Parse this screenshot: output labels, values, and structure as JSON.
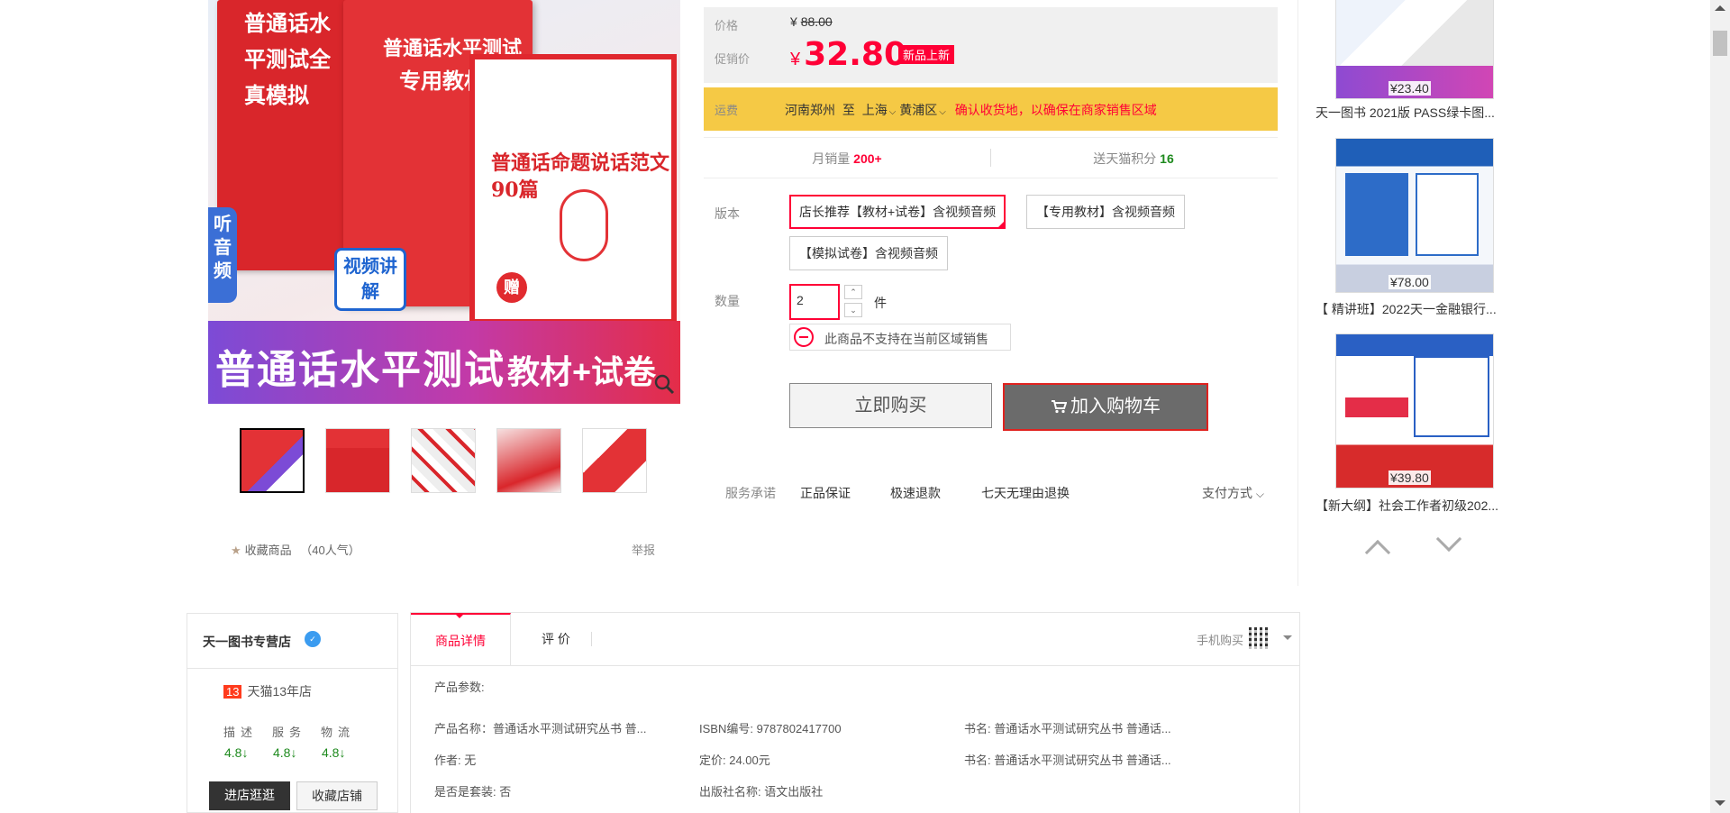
{
  "gallery": {
    "main_image": {
      "book_left_title": "普通话水平测试全真模拟",
      "book_center_title": "普通话水平测试",
      "book_center_subtitle": "专用教材",
      "book_right_title": "普通话命题说话范文90篇",
      "banner_text": "普通话水平测试",
      "banner_right": "教材+试卷",
      "listen_label": "听音频",
      "video_label": "视频讲解",
      "gift_label": "赠"
    },
    "thumbnails": [
      "main",
      "thumb-2",
      "thumb-3",
      "thumb-4",
      "thumb-5"
    ],
    "selected_thumbnail": 0,
    "favorite_label": "收藏商品",
    "favorite_count": "（40人气）",
    "report_label": "举报"
  },
  "price": {
    "list_label": "价格",
    "currency": "¥",
    "list_price": "88.00",
    "promo_label": "促销价",
    "promo_price": "32.80",
    "new_badge": "新品上新"
  },
  "shipping": {
    "label": "运费",
    "from": "河南郑州",
    "to_word": "至",
    "city": "上海",
    "district": "黄浦区",
    "warning": "确认收货地，以确保在商家销售区域"
  },
  "stats": {
    "monthly_sales_label": "月销量",
    "monthly_sales": "200+",
    "points_label": "送天猫积分",
    "points": "16"
  },
  "options": {
    "version_label": "版本",
    "versions": [
      "店长推荐【教材+试卷】含视频音频",
      "【专用教材】含视频音频",
      "【模拟试卷】含视频音频"
    ],
    "selected_version": 0,
    "quantity_label": "数量",
    "quantity": "2",
    "unit": "件",
    "region_notice": "此商品不支持在当前区域销售"
  },
  "actions": {
    "buy_now": "立即购买",
    "add_to_cart": "加入购物车"
  },
  "service": {
    "label": "服务承诺",
    "items": [
      "正品保证",
      "极速退款",
      "七天无理由退换"
    ],
    "payment": "支付方式"
  },
  "recommendations": [
    {
      "price": "¥23.40",
      "title": "天一图书 2021版 PASS绿卡图..."
    },
    {
      "price": "¥78.00",
      "title": "【 精讲班】2022天一金融银行..."
    },
    {
      "price": "¥39.80",
      "title": "【新大纲】社会工作者初级202..."
    }
  ],
  "shop": {
    "name": "天一图书专营店",
    "years_num": "13",
    "years_label": "天猫13年店",
    "score_labels": [
      "描述",
      "服务",
      "物流"
    ],
    "scores": [
      "4.8↓",
      "4.8↓",
      "4.8↓"
    ],
    "enter_button": "进店逛逛",
    "favorite_button": "收藏店铺"
  },
  "tabs": {
    "detail": "商品详情",
    "reviews": "评 价",
    "mobile_buy": "手机购买"
  },
  "params": {
    "title": "产品参数:",
    "items": [
      "产品名称：普通话水平测试研究丛书 普...",
      "ISBN编号: 9787802417700",
      "书名: 普通话水平测试研究丛书 普通话...",
      "作者: 无",
      "定价: 24.00元",
      "书名: 普通话水平测试研究丛书 普通话...",
      "是否是套装: 否",
      "出版社名称: 语文出版社"
    ]
  },
  "colors": {
    "accent": "#ff0036",
    "shipping_bg": "#f5c945",
    "cart_button": "#6b6b6b",
    "positive": "#1e8a1e"
  }
}
